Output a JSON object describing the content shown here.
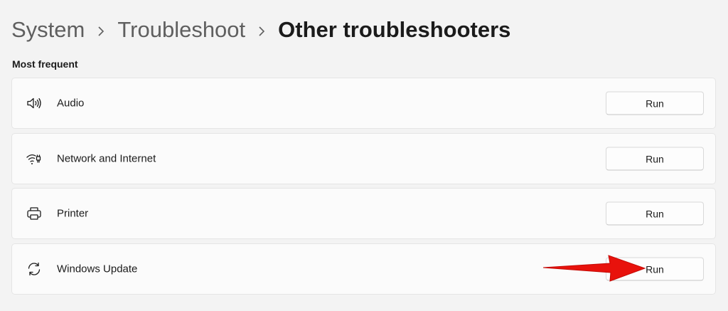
{
  "breadcrumb": {
    "items": [
      "System",
      "Troubleshoot",
      "Other troubleshooters"
    ]
  },
  "section": {
    "title": "Most frequent"
  },
  "troubleshooters": [
    {
      "label": "Audio",
      "icon": "speaker-icon",
      "button": "Run"
    },
    {
      "label": "Network and Internet",
      "icon": "wifi-ethernet-icon",
      "button": "Run"
    },
    {
      "label": "Printer",
      "icon": "printer-icon",
      "button": "Run"
    },
    {
      "label": "Windows Update",
      "icon": "sync-icon",
      "button": "Run"
    }
  ],
  "colors": {
    "background": "#f3f3f3",
    "card": "#fbfbfb",
    "annotation_arrow": "#e8120c"
  }
}
